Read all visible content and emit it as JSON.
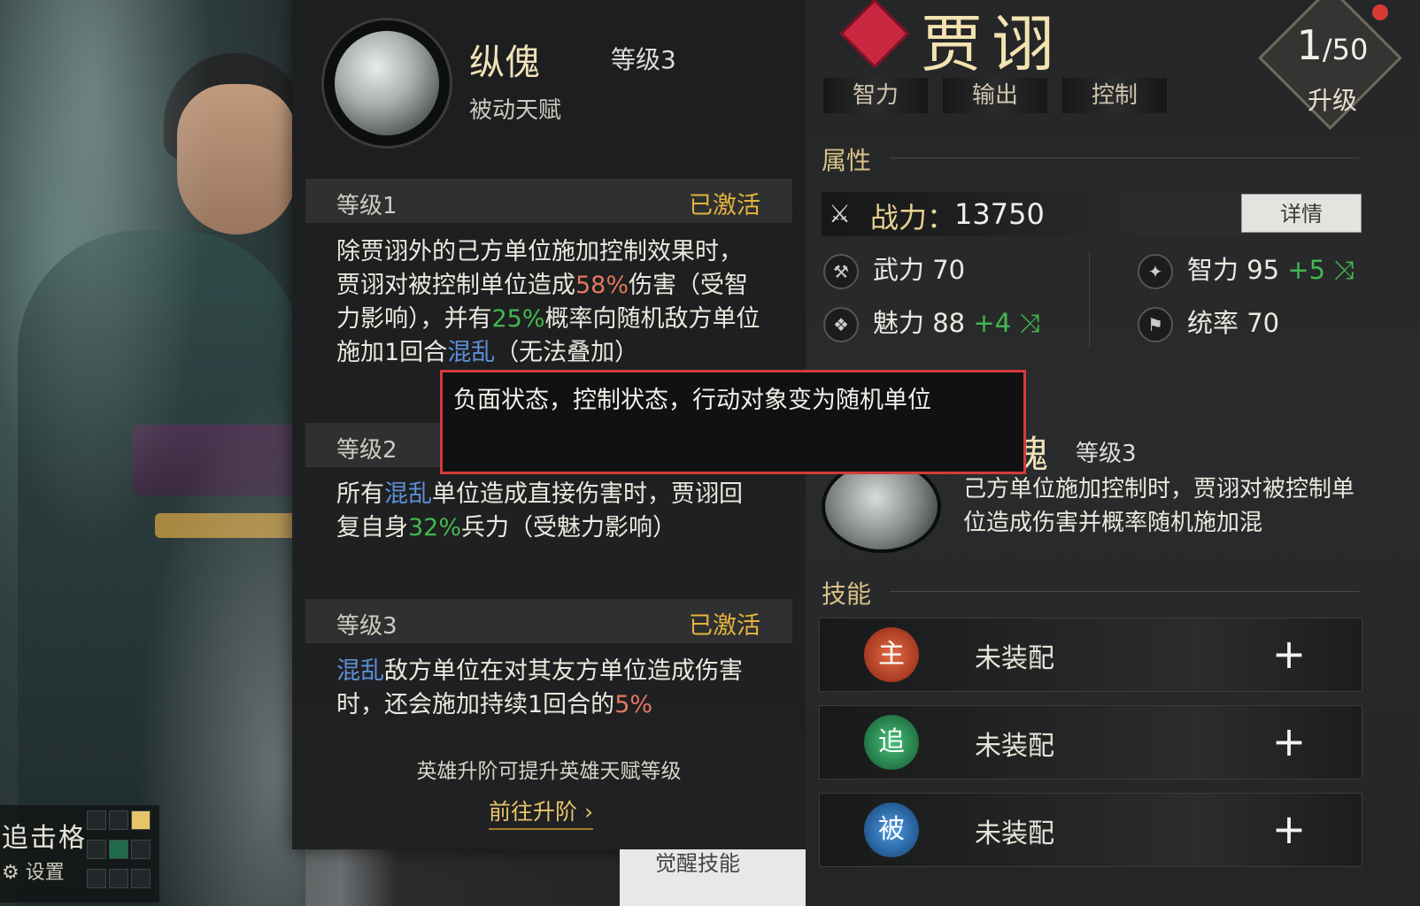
{
  "talent": {
    "name": "纵傀",
    "level": "等级3",
    "type": "被动天赋",
    "levels": [
      {
        "label": "等级1",
        "status": "已激活",
        "desc_parts": [
          "除贾诩外的己方单位施加控制效果时，贾诩对被控制单位造成",
          "58%",
          "伤害（受智力影响），并有",
          "25%",
          "概率向随机敌方单位施加1回合",
          "混乱",
          "（无法叠加）"
        ]
      },
      {
        "label": "等级2",
        "status": "",
        "desc_parts": [
          "所有",
          "混乱",
          "单位造成直接伤害时，贾诩回复自身",
          "32%",
          "兵力（受魅力影响）"
        ]
      },
      {
        "label": "等级3",
        "status": "已激活",
        "desc_parts": [
          "混乱",
          "敌方单位在对其友方单位造成伤害时，还会施加持续1回合的",
          "5%"
        ]
      }
    ],
    "hint": "英雄升阶可提升英雄天赋等级",
    "goto": "前往升阶"
  },
  "tooltip": {
    "text": "负面状态，控制状态，行动对象变为随机单位"
  },
  "chase": {
    "title": "追击格",
    "settings": "设置"
  },
  "hero": {
    "name": "贾诩",
    "tags": [
      "智力",
      "输出",
      "控制"
    ],
    "level_current": "1",
    "level_max": "/50",
    "upgrade": "升级"
  },
  "attributes": {
    "section": "属性",
    "power_label": "战力：",
    "power_value": "13750",
    "detail_button": "详情",
    "wuli": "武力 70",
    "zhili": "智力 95",
    "zhili_bonus": "+5",
    "meili": "魅力 88",
    "meili_bonus": "+4",
    "tonglv": "统率 70"
  },
  "passive": {
    "name": "纵傀",
    "level": "等级3",
    "desc": "己方单位施加控制时，贾诩对被控制单位造成伤害并概率随机施加混"
  },
  "skills": {
    "section": "技能",
    "slots": [
      {
        "badge": "主",
        "label": "未装配",
        "plus": "+",
        "color": "#d1482e"
      },
      {
        "badge": "追",
        "label": "未装配",
        "plus": "+",
        "color": "#2f9a5a"
      },
      {
        "badge": "被",
        "label": "未装配",
        "plus": "+",
        "color": "#2b77c4"
      }
    ]
  },
  "footer": {
    "text": "觉醒技能"
  }
}
